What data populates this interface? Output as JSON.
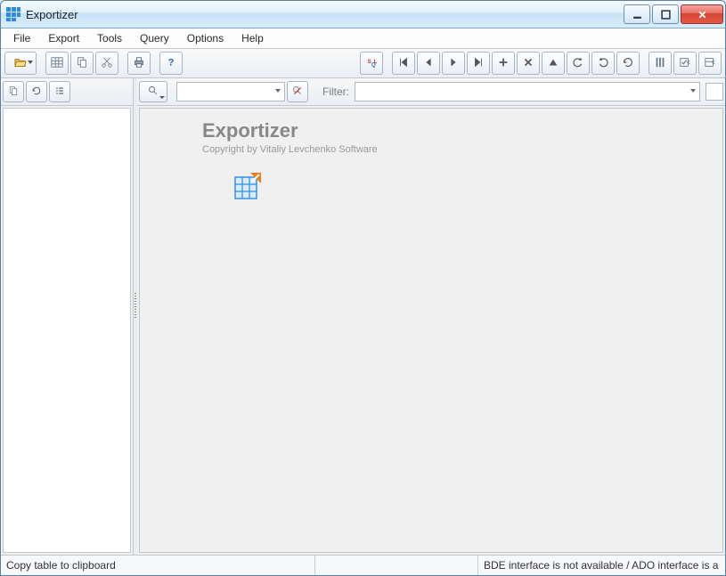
{
  "window": {
    "title": "Exportizer"
  },
  "menu": {
    "items": [
      "File",
      "Export",
      "Tools",
      "Query",
      "Options",
      "Help"
    ]
  },
  "toolbar": {
    "left": [
      "open",
      "table-view",
      "copy",
      "cut",
      "print",
      "help"
    ],
    "right": [
      "sql",
      "first",
      "prev",
      "next",
      "last",
      "add",
      "delete",
      "up",
      "undo",
      "redo",
      "refresh",
      "columns",
      "bookmark",
      "export"
    ]
  },
  "left_panel": {
    "buttons": [
      "copy",
      "refresh",
      "list"
    ]
  },
  "right_toolbar": {
    "search_button": "search",
    "combo_value": "",
    "clear_button": "clear",
    "filter_label": "Filter:",
    "filter_value": ""
  },
  "splash": {
    "title": "Exportizer",
    "subtitle": "Copyright by Vitaliy Levchenko Software"
  },
  "status": {
    "left": "Copy table to clipboard",
    "middle": "",
    "right": "BDE interface is not available / ADO interface is a"
  }
}
